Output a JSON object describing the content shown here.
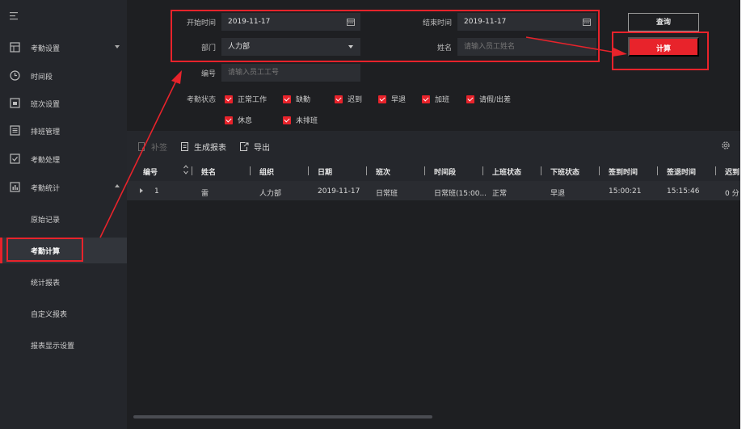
{
  "sidebar": {
    "items": [
      {
        "label": "考勤设置",
        "icon": "settings-grid-icon"
      },
      {
        "label": "时间段",
        "icon": "clock-icon"
      },
      {
        "label": "班次设置",
        "icon": "shift-calendar-icon"
      },
      {
        "label": "排班管理",
        "icon": "schedule-list-icon"
      },
      {
        "label": "考勤处理",
        "icon": "check-document-icon"
      },
      {
        "label": "考勤统计",
        "icon": "statistics-icon"
      }
    ],
    "sub_items": [
      "原始记录",
      "考勤计算",
      "统计报表",
      "自定义报表",
      "报表显示设置"
    ]
  },
  "filters": {
    "start_time_label": "开始时间",
    "start_time_value": "2019-11-17",
    "end_time_label": "结束时间",
    "end_time_value": "2019-11-17",
    "department_label": "部门",
    "department_value": "人力部",
    "name_label": "姓名",
    "name_placeholder": "请输入员工姓名",
    "id_label": "编号",
    "id_placeholder": "请输入员工工号",
    "status_label": "考勤状态",
    "statuses": [
      "正常工作",
      "缺勤",
      "迟到",
      "早退",
      "加班",
      "请假/出差",
      "休息",
      "未排班"
    ]
  },
  "buttons": {
    "query": "查询",
    "calculate": "计算"
  },
  "toolbar": {
    "supplement": "补签",
    "generate_report": "生成报表",
    "export": "导出"
  },
  "table": {
    "columns": [
      "编号",
      "姓名",
      "组织",
      "日期",
      "班次",
      "时间段",
      "上班状态",
      "下班状态",
      "签到时间",
      "签退时间",
      "迟到"
    ],
    "rows": [
      [
        "1",
        "雷",
        "人力部",
        "2019-11-17",
        "日常班",
        "日常班(15:00...",
        "正常",
        "早退",
        "15:00:21",
        "15:15:46",
        "0 分"
      ]
    ]
  },
  "colors": {
    "accent": "#e8232b",
    "sidebar_bg": "#24262b",
    "main_bg": "#1e1f22"
  }
}
